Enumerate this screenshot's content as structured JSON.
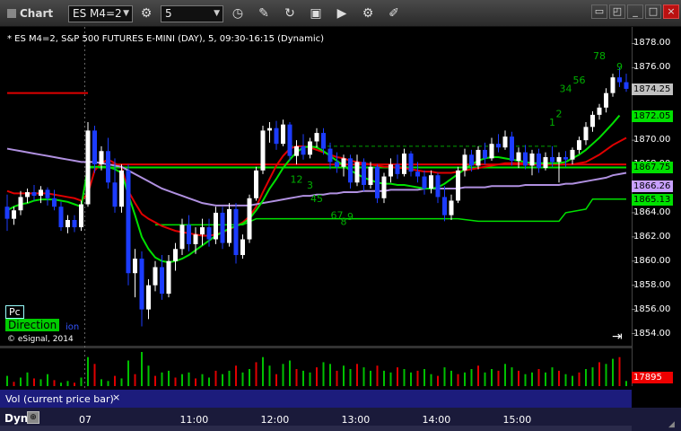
{
  "window": {
    "title": "Chart",
    "symbol": "ES M4=2",
    "interval": "5"
  },
  "toolbar_icons": [
    "link-icon",
    "clock-icon",
    "pencil-icon",
    "refresh-icon",
    "screenshot-icon",
    "play-icon",
    "gear-icon",
    "ruler-icon"
  ],
  "chart_header": "* ES M4=2, S&P 500 FUTURES E-MINI (DAY), 5, 09:30-16:15 (Dynamic)",
  "watermark": "© eSignal, 2014",
  "badges": {
    "pc": "Pc",
    "direction": "Direction",
    "direction_tail": "ion"
  },
  "volume_pane": {
    "label": "Vol (current price bar)",
    "close": "×",
    "last_value": "17895"
  },
  "xaxis": {
    "mode": "Dyn"
  },
  "chart_data": {
    "type": "candlestick",
    "title": "* ES M4=2, S&P 500 FUTURES E-MINI (DAY), 5, 09:30-16:15 (Dynamic)",
    "ylim": [
      1853,
      1879
    ],
    "yticks": [
      "1878.00",
      "1876.00",
      "1874.00",
      "1872.00",
      "1870.00",
      "1868.00",
      "1866.00",
      "1864.00",
      "1862.00",
      "1860.00",
      "1858.00",
      "1856.00",
      "1854.00"
    ],
    "xticks": [
      {
        "label": "07",
        "bar": 12
      },
      {
        "label": "11:00",
        "bar": 27
      },
      {
        "label": "12:00",
        "bar": 39
      },
      {
        "label": "13:00",
        "bar": 51
      },
      {
        "label": "14:00",
        "bar": 63
      },
      {
        "label": "15:00",
        "bar": 75
      }
    ],
    "price_tags": [
      {
        "value": 1874.25,
        "label": "1874.25",
        "color": "#c0c0c0"
      },
      {
        "value": 1872.05,
        "label": "1872.05",
        "color": "#00e000"
      },
      {
        "value": 1867.75,
        "label": "1867.75",
        "color": "#00e000"
      },
      {
        "value": 1866.26,
        "label": "1866.26",
        "color": "#c8a0ff"
      },
      {
        "value": 1865.13,
        "label": "1865.13",
        "color": "#00e000"
      }
    ],
    "candles": [
      {
        "o": 1864.5,
        "h": 1865.5,
        "l": 1862.5,
        "c": 1863.5
      },
      {
        "o": 1863.5,
        "h": 1864.5,
        "l": 1863,
        "c": 1864.2
      },
      {
        "o": 1864.2,
        "h": 1865.8,
        "l": 1863.8,
        "c": 1865.3
      },
      {
        "o": 1865.3,
        "h": 1866,
        "l": 1864.8,
        "c": 1865.7
      },
      {
        "o": 1865.7,
        "h": 1866.3,
        "l": 1865,
        "c": 1865.4
      },
      {
        "o": 1865.4,
        "h": 1866.2,
        "l": 1864.8,
        "c": 1865.9
      },
      {
        "o": 1865.9,
        "h": 1866.1,
        "l": 1864.6,
        "c": 1865.2
      },
      {
        "o": 1865.2,
        "h": 1865.9,
        "l": 1864.2,
        "c": 1864.5
      },
      {
        "o": 1864.5,
        "h": 1864.9,
        "l": 1862.5,
        "c": 1862.8
      },
      {
        "o": 1862.8,
        "h": 1863.8,
        "l": 1862.3,
        "c": 1863.4
      },
      {
        "o": 1863.4,
        "h": 1863.8,
        "l": 1862.4,
        "c": 1862.8
      },
      {
        "o": 1862.8,
        "h": 1865,
        "l": 1862.5,
        "c": 1864.7
      },
      {
        "o": 1864.7,
        "h": 1871.5,
        "l": 1864.5,
        "c": 1870.8
      },
      {
        "o": 1870.8,
        "h": 1871.2,
        "l": 1867.3,
        "c": 1868
      },
      {
        "o": 1868,
        "h": 1869.5,
        "l": 1867.5,
        "c": 1869.1
      },
      {
        "o": 1869.1,
        "h": 1870.2,
        "l": 1866,
        "c": 1866.5
      },
      {
        "o": 1866.5,
        "h": 1868.5,
        "l": 1864,
        "c": 1864.5
      },
      {
        "o": 1864.5,
        "h": 1868,
        "l": 1864,
        "c": 1867.5
      },
      {
        "o": 1867.5,
        "h": 1868,
        "l": 1858,
        "c": 1859
      },
      {
        "o": 1859,
        "h": 1861,
        "l": 1857,
        "c": 1860.2
      },
      {
        "o": 1860.2,
        "h": 1860.8,
        "l": 1854.6,
        "c": 1856
      },
      {
        "o": 1856,
        "h": 1858.5,
        "l": 1855.2,
        "c": 1858
      },
      {
        "o": 1858,
        "h": 1860,
        "l": 1857.5,
        "c": 1859.5
      },
      {
        "o": 1859.5,
        "h": 1860.5,
        "l": 1856.8,
        "c": 1857.3
      },
      {
        "o": 1857.3,
        "h": 1860.5,
        "l": 1857,
        "c": 1860
      },
      {
        "o": 1860,
        "h": 1861.5,
        "l": 1859.2,
        "c": 1861
      },
      {
        "o": 1861,
        "h": 1863.5,
        "l": 1860.5,
        "c": 1863
      },
      {
        "o": 1863,
        "h": 1863.8,
        "l": 1860.8,
        "c": 1861.4
      },
      {
        "o": 1861.4,
        "h": 1862.8,
        "l": 1860.6,
        "c": 1862.2
      },
      {
        "o": 1862.2,
        "h": 1863.5,
        "l": 1861.3,
        "c": 1862.8
      },
      {
        "o": 1862.8,
        "h": 1863.5,
        "l": 1861.2,
        "c": 1861.8
      },
      {
        "o": 1861.8,
        "h": 1864.5,
        "l": 1861.4,
        "c": 1864
      },
      {
        "o": 1864,
        "h": 1864.5,
        "l": 1861,
        "c": 1861.5
      },
      {
        "o": 1861.5,
        "h": 1864.8,
        "l": 1861.2,
        "c": 1864.3
      },
      {
        "o": 1864.3,
        "h": 1864.8,
        "l": 1859.8,
        "c": 1860.5
      },
      {
        "o": 1860.5,
        "h": 1862.2,
        "l": 1860.2,
        "c": 1861.8
      },
      {
        "o": 1861.8,
        "h": 1865.5,
        "l": 1861.5,
        "c": 1865.2
      },
      {
        "o": 1865.2,
        "h": 1867.8,
        "l": 1865,
        "c": 1867.5
      },
      {
        "o": 1867.5,
        "h": 1871.2,
        "l": 1867.2,
        "c": 1870.8
      },
      {
        "o": 1870.8,
        "h": 1871.5,
        "l": 1869.8,
        "c": 1871
      },
      {
        "o": 1871,
        "h": 1871.6,
        "l": 1869.2,
        "c": 1869.7
      },
      {
        "o": 1869.7,
        "h": 1871.7,
        "l": 1869.5,
        "c": 1871.3
      },
      {
        "o": 1871.3,
        "h": 1871.5,
        "l": 1868.3,
        "c": 1868.7
      },
      {
        "o": 1868.7,
        "h": 1870,
        "l": 1868,
        "c": 1869.5
      },
      {
        "o": 1869.5,
        "h": 1870.5,
        "l": 1868.4,
        "c": 1868.8
      },
      {
        "o": 1868.8,
        "h": 1870.2,
        "l": 1868.5,
        "c": 1869.9
      },
      {
        "o": 1869.9,
        "h": 1871,
        "l": 1869.4,
        "c": 1870.6
      },
      {
        "o": 1870.6,
        "h": 1871,
        "l": 1868.8,
        "c": 1869.3
      },
      {
        "o": 1869.3,
        "h": 1869.8,
        "l": 1867.6,
        "c": 1868.2
      },
      {
        "o": 1868.2,
        "h": 1869,
        "l": 1867.3,
        "c": 1867.8
      },
      {
        "o": 1867.8,
        "h": 1868.8,
        "l": 1867,
        "c": 1868.5
      },
      {
        "o": 1868.5,
        "h": 1868.8,
        "l": 1866,
        "c": 1866.5
      },
      {
        "o": 1866.5,
        "h": 1868.8,
        "l": 1866.2,
        "c": 1868.2
      },
      {
        "o": 1868.2,
        "h": 1868.5,
        "l": 1865.8,
        "c": 1866.3
      },
      {
        "o": 1866.3,
        "h": 1868.2,
        "l": 1866,
        "c": 1867.8
      },
      {
        "o": 1867.8,
        "h": 1868,
        "l": 1864.8,
        "c": 1865.2
      },
      {
        "o": 1865.2,
        "h": 1867.3,
        "l": 1864.8,
        "c": 1867
      },
      {
        "o": 1867,
        "h": 1868.5,
        "l": 1866.5,
        "c": 1868
      },
      {
        "o": 1868,
        "h": 1868.8,
        "l": 1866.8,
        "c": 1867.2
      },
      {
        "o": 1867.2,
        "h": 1869.3,
        "l": 1867,
        "c": 1868.9
      },
      {
        "o": 1868.9,
        "h": 1869.1,
        "l": 1867,
        "c": 1867.4
      },
      {
        "o": 1867.4,
        "h": 1868.2,
        "l": 1866.5,
        "c": 1867
      },
      {
        "o": 1867,
        "h": 1867.5,
        "l": 1865.5,
        "c": 1866
      },
      {
        "o": 1866,
        "h": 1867.5,
        "l": 1865.6,
        "c": 1867.1
      },
      {
        "o": 1867.1,
        "h": 1867.3,
        "l": 1864.8,
        "c": 1865.3
      },
      {
        "o": 1865.3,
        "h": 1866.2,
        "l": 1863.3,
        "c": 1863.8
      },
      {
        "o": 1863.8,
        "h": 1865.5,
        "l": 1863.4,
        "c": 1865
      },
      {
        "o": 1865,
        "h": 1867.8,
        "l": 1864.8,
        "c": 1867.5
      },
      {
        "o": 1867.5,
        "h": 1869.3,
        "l": 1867,
        "c": 1868.8
      },
      {
        "o": 1868.8,
        "h": 1869.2,
        "l": 1867.4,
        "c": 1867.9
      },
      {
        "o": 1867.9,
        "h": 1869.5,
        "l": 1867.6,
        "c": 1869.2
      },
      {
        "o": 1869.2,
        "h": 1869.8,
        "l": 1868,
        "c": 1868.5
      },
      {
        "o": 1868.5,
        "h": 1870.2,
        "l": 1868.3,
        "c": 1869.7
      },
      {
        "o": 1869.7,
        "h": 1870.5,
        "l": 1869,
        "c": 1869.4
      },
      {
        "o": 1869.4,
        "h": 1870.8,
        "l": 1869.2,
        "c": 1870.3
      },
      {
        "o": 1870.3,
        "h": 1870.7,
        "l": 1867.9,
        "c": 1868.3
      },
      {
        "o": 1868.3,
        "h": 1869.4,
        "l": 1867.7,
        "c": 1869
      },
      {
        "o": 1869,
        "h": 1869.6,
        "l": 1867.6,
        "c": 1867.9
      },
      {
        "o": 1867.9,
        "h": 1869.2,
        "l": 1867.1,
        "c": 1868.9
      },
      {
        "o": 1868.9,
        "h": 1869.3,
        "l": 1867.3,
        "c": 1867.7
      },
      {
        "o": 1867.7,
        "h": 1869,
        "l": 1867.5,
        "c": 1868.6
      },
      {
        "o": 1868.6,
        "h": 1869.5,
        "l": 1867.8,
        "c": 1868.2
      },
      {
        "o": 1868.2,
        "h": 1869,
        "l": 1866.5,
        "c": 1868.6
      },
      {
        "o": 1868.6,
        "h": 1869.1,
        "l": 1867.8,
        "c": 1868.4
      },
      {
        "o": 1868.4,
        "h": 1869.4,
        "l": 1868,
        "c": 1869.2
      },
      {
        "o": 1869.2,
        "h": 1870.3,
        "l": 1868.9,
        "c": 1870
      },
      {
        "o": 1870,
        "h": 1871.5,
        "l": 1869.6,
        "c": 1871.1
      },
      {
        "o": 1871.1,
        "h": 1872.4,
        "l": 1870.7,
        "c": 1872.1
      },
      {
        "o": 1872.1,
        "h": 1873,
        "l": 1871.7,
        "c": 1872.7
      },
      {
        "o": 1872.7,
        "h": 1874.3,
        "l": 1872.3,
        "c": 1873.9
      },
      {
        "o": 1873.9,
        "h": 1875.5,
        "l": 1873.6,
        "c": 1875.2
      },
      {
        "o": 1875.2,
        "h": 1876,
        "l": 1874.4,
        "c": 1874.8
      },
      {
        "o": 1874.8,
        "h": 1875.5,
        "l": 1874,
        "c": 1874.25
      }
    ],
    "series": [
      {
        "name": "",
        "color": "#e00000",
        "values": [
          1865.8,
          1865.6,
          1865.6,
          1865.6,
          1865.6,
          1865.6,
          1865.6,
          1865.5,
          1865.4,
          1865.3,
          1865.2,
          1865,
          1865.6,
          1867.5,
          1868.1,
          1868.4,
          1868.1,
          1867.7,
          1865.8,
          1864.8,
          1863.9,
          1863.5,
          1863.2,
          1862.9,
          1862.7,
          1862.5,
          1862.4,
          1862.3,
          1862.2,
          1862.1,
          1862.1,
          1862.2,
          1862.4,
          1862.6,
          1862.9,
          1863.2,
          1863.7,
          1864.5,
          1865.7,
          1866.8,
          1867.9,
          1868.7,
          1869.3,
          1869.5,
          1869.5,
          1869.4,
          1869.2,
          1869,
          1868.8,
          1868.6,
          1868.5,
          1868.3,
          1868.2,
          1868.1,
          1868,
          1867.9,
          1867.8,
          1867.8,
          1867.7,
          1867.7,
          1867.6,
          1867.5,
          1867.4,
          1867.4,
          1867.3,
          1867.3,
          1867.3,
          1867.4,
          1867.5,
          1867.6,
          1867.7,
          1867.8,
          1867.9,
          1868,
          1868.1,
          1868.1,
          1868.1,
          1868.1,
          1868,
          1868,
          1868,
          1868,
          1868,
          1868,
          1868,
          1868.1,
          1868.2,
          1868.5,
          1868.8,
          1869.2,
          1869.6,
          1869.9,
          1870.2
        ]
      },
      {
        "name": "",
        "color": "#b090e0",
        "values": [
          1869.3,
          1869.2,
          1869.1,
          1869,
          1868.9,
          1868.8,
          1868.7,
          1868.6,
          1868.5,
          1868.4,
          1868.3,
          1868.2,
          1868.2,
          1868.2,
          1868.1,
          1868,
          1867.9,
          1867.8,
          1867.5,
          1867.2,
          1866.9,
          1866.6,
          1866.3,
          1866,
          1865.8,
          1865.6,
          1865.4,
          1865.2,
          1865,
          1864.8,
          1864.7,
          1864.6,
          1864.6,
          1864.6,
          1864.6,
          1864.6,
          1864.6,
          1864.7,
          1864.8,
          1864.9,
          1865,
          1865.1,
          1865.2,
          1865.3,
          1865.4,
          1865.4,
          1865.5,
          1865.5,
          1865.6,
          1865.6,
          1865.7,
          1865.7,
          1865.7,
          1865.8,
          1865.8,
          1865.8,
          1865.8,
          1865.9,
          1865.9,
          1865.9,
          1865.9,
          1865.9,
          1866,
          1866,
          1866,
          1866,
          1866,
          1866,
          1866.1,
          1866.1,
          1866.1,
          1866.1,
          1866.2,
          1866.2,
          1866.2,
          1866.2,
          1866.2,
          1866.3,
          1866.3,
          1866.3,
          1866.3,
          1866.3,
          1866.3,
          1866.4,
          1866.4,
          1866.5,
          1866.6,
          1866.7,
          1866.8,
          1866.9,
          1867.1,
          1867.2,
          1867.3
        ]
      },
      {
        "name": "",
        "color": "#00e000",
        "values": [
          1864.2,
          1864.5,
          1864.7,
          1864.8,
          1865,
          1865.1,
          1865.1,
          1865.1,
          1865,
          1864.9,
          1864.7,
          1864.5,
          1867.8,
          1867.8,
          1867.8,
          1867.8,
          1867.6,
          1867.3,
          1865.5,
          1863.8,
          1862,
          1861,
          1860.3,
          1860,
          1859.9,
          1860,
          1860.2,
          1860.5,
          1860.9,
          1861.3,
          1861.7,
          1862.1,
          1862.4,
          1862.7,
          1862.9,
          1863.1,
          1863.5,
          1864.2,
          1865,
          1866,
          1866.8,
          1867.7,
          1868.4,
          1869,
          1869.4,
          1869.5,
          1869.4,
          1869.1,
          1868.7,
          1868.3,
          1867.9,
          1867.5,
          1867.2,
          1866.9,
          1866.7,
          1866.5,
          1866.4,
          1866.4,
          1866.3,
          1866.3,
          1866.2,
          1866.1,
          1866,
          1866,
          1866.1,
          1866.4,
          1866.8,
          1867.2,
          1867.6,
          1868,
          1868.3,
          1868.5,
          1868.6,
          1868.6,
          1868.5,
          1868.4,
          1868.3,
          1868.2,
          1868.1,
          1868.1,
          1868.1,
          1868.1,
          1868.1,
          1868.2,
          1868.5,
          1868.8,
          1869.2,
          1869.7,
          1870.2,
          1870.8,
          1871.4,
          1872.05
        ]
      }
    ],
    "levels": [
      {
        "value": 1873.9,
        "color": "#e00000",
        "x_from_bar": 0,
        "x_to_bar": 12
      },
      {
        "value": 1867.75,
        "color": "#00e000",
        "x_from_bar": 12,
        "x_to_bar": 92
      },
      {
        "value": 1868.0,
        "color": "#e00000",
        "x_from_bar": 15,
        "x_to_bar": 92
      },
      {
        "value": 1869.5,
        "color": "#00a000",
        "dashed": true,
        "x_from_bar": 42,
        "x_to_bar": 82
      }
    ],
    "stops": [
      {
        "value": 1863,
        "color": "#00e000",
        "points": [
          [
            22,
            1863
          ],
          [
            35,
            1863
          ],
          [
            37,
            1863.5
          ],
          [
            45,
            1863.5
          ],
          [
            67,
            1863.5
          ],
          [
            70,
            1863.3
          ],
          [
            82,
            1863.3
          ],
          [
            83,
            1864
          ],
          [
            86,
            1864.3
          ],
          [
            87,
            1865.13
          ],
          [
            92,
            1865.13
          ]
        ]
      }
    ],
    "counts": [
      {
        "label": "12",
        "bar": 43,
        "value": 1866.5
      },
      {
        "label": "3",
        "bar": 45,
        "value": 1866
      },
      {
        "label": "45",
        "bar": 46,
        "value": 1864.9
      },
      {
        "label": "67",
        "bar": 49,
        "value": 1863.5
      },
      {
        "label": "8",
        "bar": 50,
        "value": 1863
      },
      {
        "label": "9",
        "bar": 51,
        "value": 1863.4
      },
      {
        "label": "1",
        "bar": 81,
        "value": 1871.2
      },
      {
        "label": "2",
        "bar": 82,
        "value": 1871.9
      },
      {
        "label": "34",
        "bar": 83,
        "value": 1874
      },
      {
        "label": "56",
        "bar": 85,
        "value": 1874.7
      },
      {
        "label": "78",
        "bar": 88,
        "value": 1876.7
      },
      {
        "label": "9",
        "bar": 91,
        "value": 1875.8
      }
    ],
    "volume": [
      12,
      5,
      10,
      16,
      9,
      8,
      14,
      7,
      4,
      6,
      4,
      10,
      34,
      26,
      8,
      6,
      12,
      9,
      30,
      14,
      40,
      24,
      12,
      16,
      18,
      10,
      14,
      16,
      9,
      14,
      10,
      18,
      14,
      18,
      24,
      16,
      20,
      28,
      34,
      24,
      14,
      26,
      30,
      20,
      18,
      16,
      22,
      28,
      26,
      18,
      24,
      20,
      26,
      22,
      18,
      24,
      18,
      16,
      22,
      20,
      16,
      18,
      20,
      14,
      12,
      22,
      18,
      14,
      16,
      20,
      24,
      16,
      20,
      18,
      26,
      22,
      18,
      14,
      16,
      20,
      16,
      22,
      18,
      14,
      12,
      16,
      20,
      22,
      28,
      26,
      32,
      34,
      6
    ],
    "volume_colors": [
      "#00c000",
      "#e00000"
    ]
  }
}
